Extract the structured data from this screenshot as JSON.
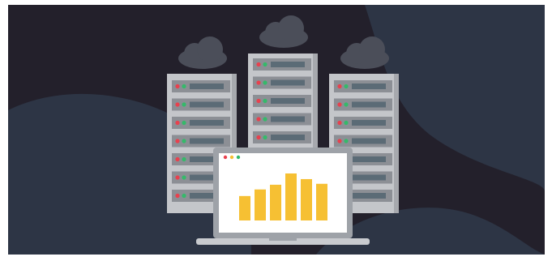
{
  "illustration": {
    "subject": "server-racks-with-laptop-bar-chart",
    "icons": [
      "cloud-icon",
      "server-rack-icon",
      "laptop-icon",
      "bar-chart-icon"
    ]
  },
  "colors": {
    "background_dark": "#23202b",
    "background_wave": "#2d3545",
    "cloud": "#4b4e59",
    "rack_body": "#c4c6ca",
    "rack_shadow": "#a7a9ae",
    "slot": "#8c8f95",
    "slot_display": "#5b6b76",
    "led_red": "#e8414e",
    "led_green": "#35b96a",
    "laptop_frame": "#9ea2a8",
    "laptop_screen": "#ffffff",
    "laptop_base": "#c9cbcf",
    "bar": "#f6c033",
    "dot_red": "#e8414e",
    "dot_yellow": "#f6c033",
    "dot_green": "#35b96a"
  },
  "bar_levels": [
    0.52,
    0.66,
    0.76,
    1.0,
    0.88,
    0.78
  ]
}
